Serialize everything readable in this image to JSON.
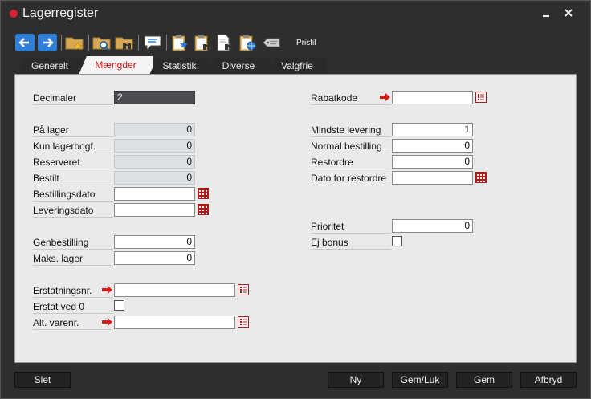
{
  "window": {
    "title": "Lagerregister"
  },
  "toolbar": {
    "prisfil_label": "Prisfil"
  },
  "tabs": [
    {
      "label": "Generelt",
      "active": false
    },
    {
      "label": "Mængder",
      "active": true
    },
    {
      "label": "Statistik",
      "active": false
    },
    {
      "label": "Diverse",
      "active": false
    },
    {
      "label": "Valgfrie",
      "active": false
    }
  ],
  "left": {
    "decimaler": {
      "label": "Decimaler",
      "value": "2"
    },
    "paa_lager": {
      "label": "På lager",
      "value": "0"
    },
    "kun_lagerbogf": {
      "label": "Kun lagerbogf.",
      "value": "0"
    },
    "reserveret": {
      "label": "Reserveret",
      "value": "0"
    },
    "bestilt": {
      "label": "Bestilt",
      "value": "0"
    },
    "bestillingsdato": {
      "label": "Bestillingsdato",
      "value": ""
    },
    "leveringsdato": {
      "label": "Leveringsdato",
      "value": ""
    },
    "genbestilling": {
      "label": "Genbestilling",
      "value": "0"
    },
    "maks_lager": {
      "label": "Maks. lager",
      "value": "0"
    },
    "erstatningsnr": {
      "label": "Erstatningsnr.",
      "value": ""
    },
    "erstat_ved_0": {
      "label": "Erstat ved 0",
      "checked": false
    },
    "alt_varenr": {
      "label": "Alt. varenr.",
      "value": ""
    }
  },
  "right": {
    "rabatkode": {
      "label": "Rabatkode",
      "value": ""
    },
    "mindste_levering": {
      "label": "Mindste levering",
      "value": "1"
    },
    "normal_bestilling": {
      "label": "Normal bestilling",
      "value": "0"
    },
    "restordre": {
      "label": "Restordre",
      "value": "0"
    },
    "dato_for_restordre": {
      "label": "Dato for restordre",
      "value": ""
    },
    "prioritet": {
      "label": "Prioritet",
      "value": "0"
    },
    "ej_bonus": {
      "label": "Ej bonus",
      "checked": false
    }
  },
  "buttons": {
    "slet": "Slet",
    "ny": "Ny",
    "gem_luk": "Gem/Luk",
    "gem": "Gem",
    "afbryd": "Afbryd"
  },
  "colors": {
    "accent_red": "#cc1111",
    "toolbar_blue": "#2f7fd8",
    "window_bg": "#2e2e2e",
    "panel_bg": "#eaeaea"
  }
}
